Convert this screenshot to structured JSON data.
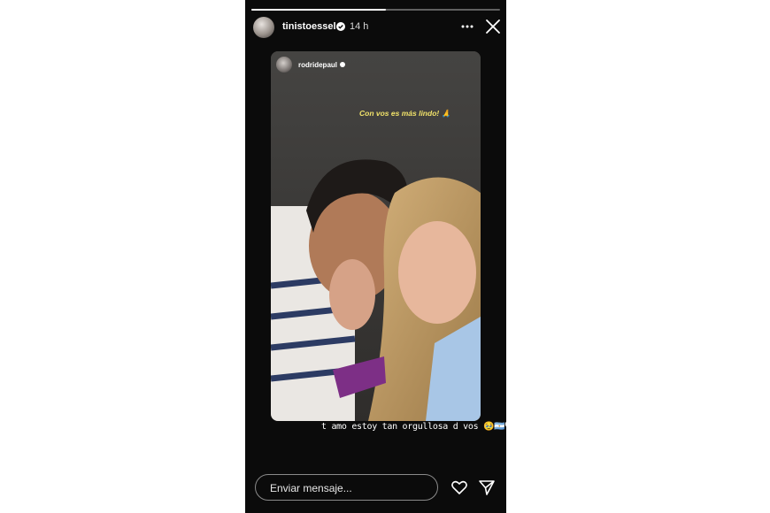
{
  "story": {
    "progress_fraction": 0.54,
    "header": {
      "username": "tinistoessel",
      "time": "14 h",
      "icons": [
        "verified-icon",
        "more-options-icon",
        "close-icon"
      ]
    },
    "repost": {
      "username": "rodridepaul",
      "sticker_text": "Con vos es más lindo! 🙏"
    },
    "caption": "t amo estoy tan orgullosa d vos 🥹🇦🇷🤍",
    "composer": {
      "placeholder": "Enviar mensaje..."
    },
    "actions": [
      "heart-icon",
      "send-icon"
    ]
  },
  "colors": {
    "story_bg": "#0b0b0b",
    "page_bg": "#ffffff",
    "sticker_text": "#f2e36a"
  }
}
